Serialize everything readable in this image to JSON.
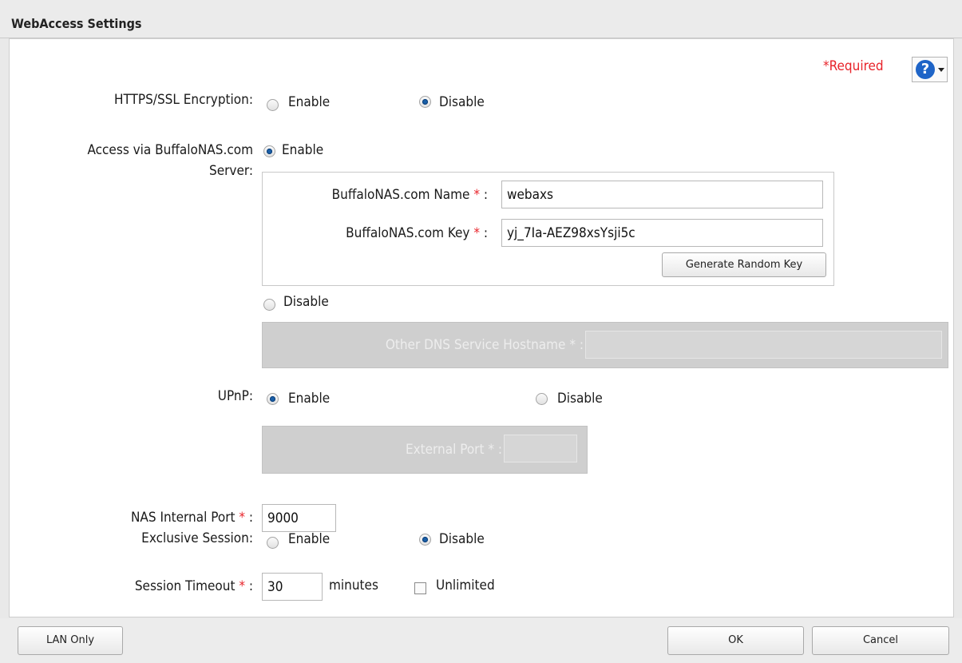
{
  "window": {
    "title": "WebAccess Settings"
  },
  "required_label": "*Required",
  "help": {
    "glyph": "?"
  },
  "https": {
    "label": "HTTPS/SSL Encryption:",
    "enable": "Enable",
    "disable": "Disable",
    "selected": "Disable"
  },
  "buffalo": {
    "label_line1": "Access via BuffaloNAS.com",
    "label_line2": "Server:",
    "enable": "Enable",
    "disable": "Disable",
    "selected": "Enable",
    "name_label": "BuffaloNAS.com Name",
    "name_value": "webaxs",
    "key_label": "BuffaloNAS.com Key",
    "key_value": "yj_7Ia-AEZ98xsYsji5c",
    "generate_button": "Generate Random Key",
    "other_dns_label": "Other DNS Service Hostname",
    "other_dns_value": ""
  },
  "upnp": {
    "label": "UPnP:",
    "enable": "Enable",
    "disable": "Disable",
    "selected": "Enable",
    "external_port_label": "External Port",
    "external_port_value": ""
  },
  "nas_port": {
    "label": "NAS Internal Port",
    "value": "9000"
  },
  "exclusive": {
    "label": "Exclusive Session:",
    "enable": "Enable",
    "disable": "Disable",
    "selected": "Disable"
  },
  "timeout": {
    "label": "Session Timeout",
    "value": "30",
    "unit": "minutes",
    "unlimited_label": "Unlimited",
    "unlimited_checked": false
  },
  "required_marker": "*",
  "colon": ":",
  "footer": {
    "lan_only": "LAN Only",
    "ok": "OK",
    "cancel": "Cancel"
  }
}
